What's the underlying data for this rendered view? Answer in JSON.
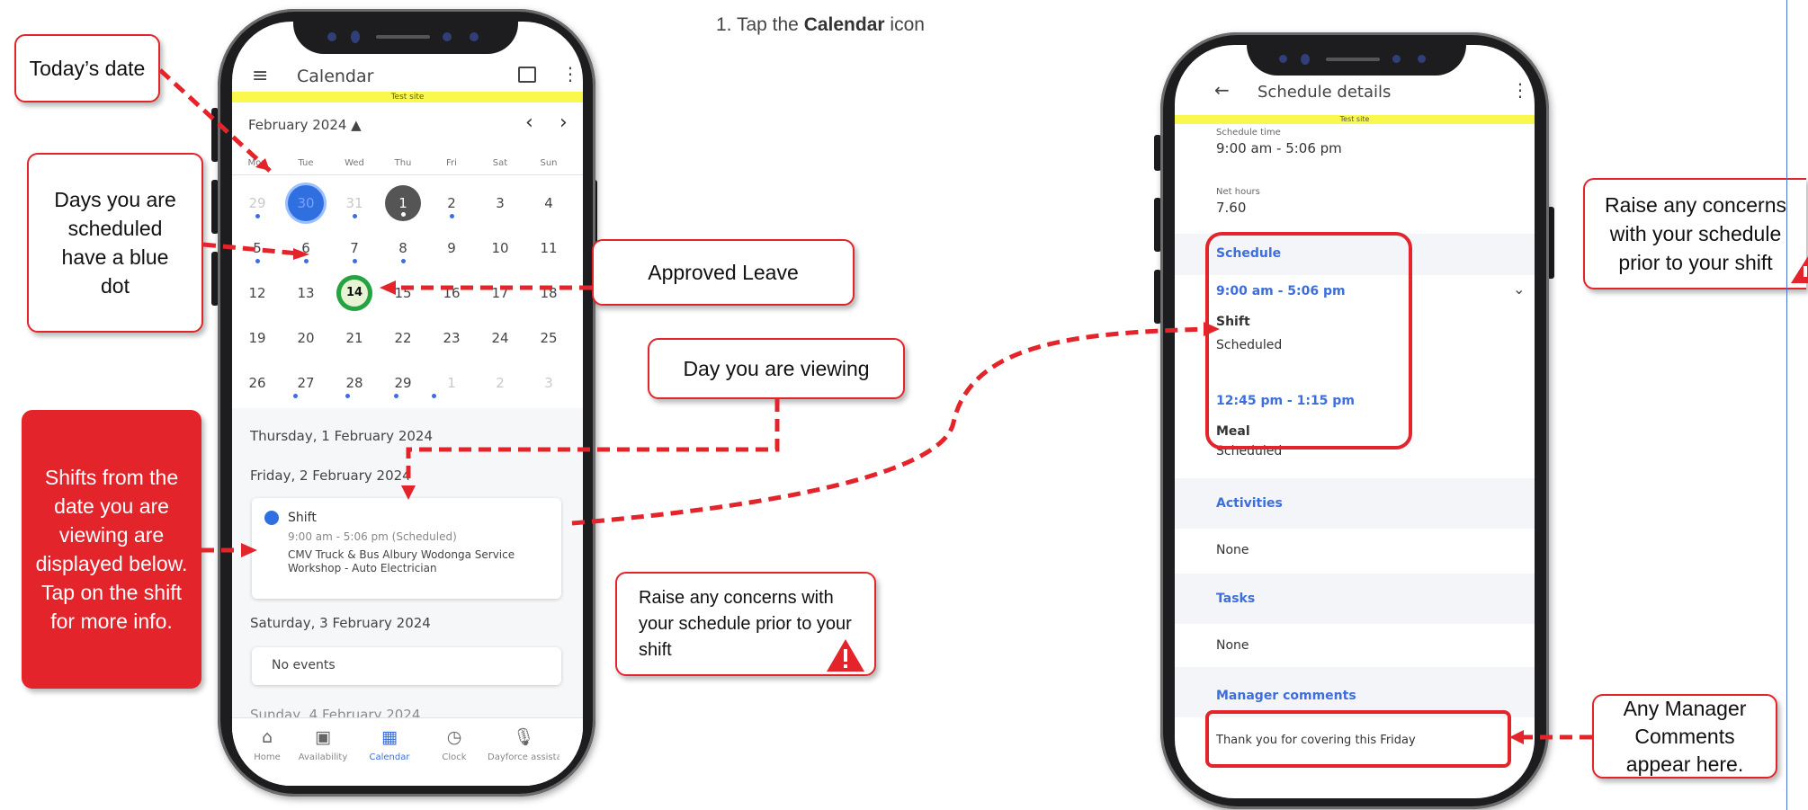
{
  "instruction": {
    "prefix": "1. Tap the ",
    "bold": "Calendar",
    "suffix": " icon"
  },
  "callouts": {
    "todays_date": "Today’s date",
    "scheduled_days": "Days you are scheduled have a blue dot",
    "shifts_info": "Shifts from the date you are viewing are displayed below. Tap on the shift for more info.",
    "approved_leave": "Approved Leave",
    "day_viewing": "Day you are viewing",
    "concerns_left": "Raise any concerns with your schedule prior to your shift",
    "concerns_right": "Raise any concerns with your schedule prior to your shift",
    "manager_comments": "Any Manager Comments appear here."
  },
  "calendar_screen": {
    "menu_icon": "hamburger-menu-icon",
    "title": "Calendar",
    "test_site": "Test site",
    "month": "February 2024 ▲",
    "prev": "‹",
    "next": "›",
    "days_of_week": [
      "Mon",
      "Tue",
      "Wed",
      "Thu",
      "Fri",
      "Sat",
      "Sun"
    ],
    "weeks": [
      [
        "29",
        "30",
        "31",
        "1",
        "2",
        "3",
        "4"
      ],
      [
        "5",
        "6",
        "7",
        "8",
        "9",
        "10",
        "11"
      ],
      [
        "12",
        "13",
        "14",
        "15",
        "16",
        "17",
        "18"
      ],
      [
        "19",
        "20",
        "21",
        "22",
        "23",
        "24",
        "25"
      ],
      [
        "26",
        "27",
        "28",
        "29",
        "1",
        "2",
        "3"
      ]
    ],
    "sections": {
      "thu": "Thursday, 1 February 2024",
      "fri": "Friday, 2 February 2024",
      "sat": "Saturday, 3 February 2024",
      "sun": "Sunday, 4 February 2024"
    },
    "shift_card": {
      "title": "Shift",
      "time": "9:00 am - 5:06 pm (Scheduled)",
      "location": "CMV Truck & Bus Albury Wodonga Service Workshop - Auto Electrician"
    },
    "no_events": "No events",
    "nav": [
      {
        "label": "Home",
        "icon": "home-icon"
      },
      {
        "label": "Availability",
        "icon": "availability-icon"
      },
      {
        "label": "Calendar",
        "icon": "calendar-icon"
      },
      {
        "label": "Clock",
        "icon": "clock-icon"
      },
      {
        "label": "Dayforce assistant",
        "icon": "microphone-icon"
      }
    ]
  },
  "details_screen": {
    "title": "Schedule details",
    "test_site": "Test site",
    "schedule_time_label": "Schedule time",
    "schedule_time": "9:00 am - 5:06 pm",
    "net_hours_label": "Net hours",
    "net_hours": "7.60",
    "schedule_heading": "Schedule",
    "shift_time": "9:00 am - 5:06 pm",
    "shift_label": "Shift",
    "shift_status": "Scheduled",
    "meal_time": "12:45 pm - 1:15 pm",
    "meal_label": "Meal",
    "meal_status": "Scheduled",
    "activities_heading": "Activities",
    "activities_value": "None",
    "tasks_heading": "Tasks",
    "tasks_value": "None",
    "manager_heading": "Manager comments",
    "manager_comment": "Thank you for covering this Friday"
  },
  "colors": {
    "accent_red": "#e3242b",
    "blue": "#3c6edc",
    "test_banner": "#faf84c",
    "leave_green": "#25a244"
  }
}
